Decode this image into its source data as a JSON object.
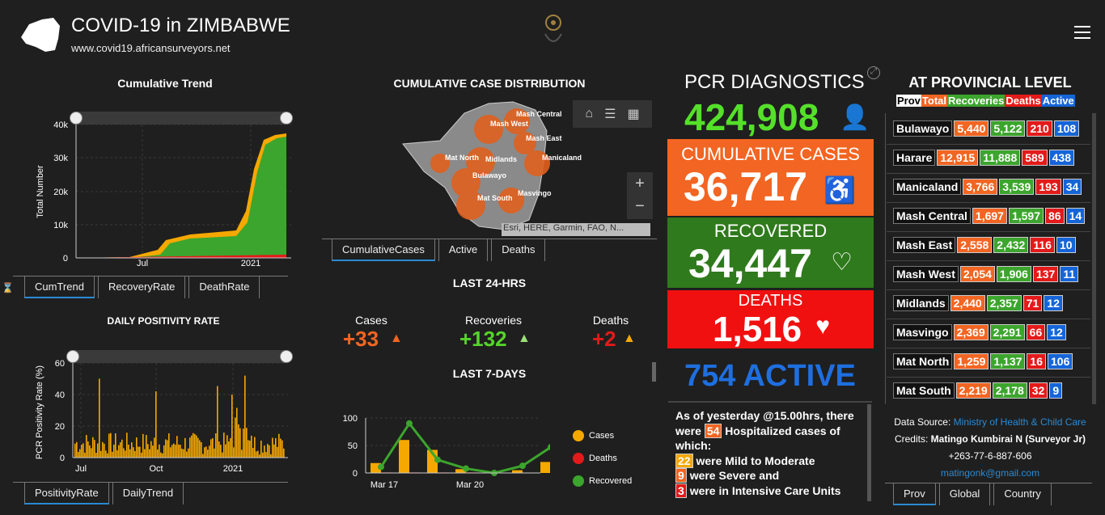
{
  "header": {
    "title": "COVID-19 in ZIMBABWE",
    "url": "www.covid19.africansurveyors.net"
  },
  "trend": {
    "title": "Cumulative Trend",
    "ylabel": "Total Number",
    "yticks": [
      "40k",
      "30k",
      "20k",
      "10k",
      "0"
    ],
    "xticks": [
      "Jul",
      "2021"
    ],
    "tabs": [
      "CumTrend",
      "RecoveryRate",
      "DeathRate"
    ]
  },
  "positivity": {
    "title": "DAILY POSITIVITY RATE",
    "ylabel": "PCR Positivity Rate (%)",
    "yticks": [
      "60",
      "40",
      "20",
      "0"
    ],
    "xticks": [
      "Jul",
      "Oct",
      "2021"
    ],
    "tabs": [
      "PositivityRate",
      "DailyTrend"
    ]
  },
  "map": {
    "title": "CUMULATIVE CASE DISTRIBUTION",
    "labels": [
      "Mash Central",
      "Mash West",
      "Mash East",
      "Manicaland",
      "Mat North",
      "Midlands",
      "Bulawayo",
      "Mat South",
      "Masvingo"
    ],
    "attribution": "Esri, HERE, Garmin, FAO, N...",
    "tabs": [
      "CumulativeCases",
      "Active",
      "Deaths"
    ],
    "zoom_in": "+",
    "zoom_out": "−"
  },
  "last24": {
    "title": "LAST 24-HRS",
    "cases_label": "Cases",
    "cases": "+33",
    "recoveries_label": "Recoveries",
    "recoveries": "+132",
    "deaths_label": "Deaths",
    "deaths": "+2"
  },
  "last7": {
    "title": "LAST 7-DAYS",
    "yticks": [
      "100",
      "50",
      "0"
    ],
    "xticks": [
      "Mar 17",
      "Mar 20"
    ],
    "legend": [
      "Cases",
      "Deaths",
      "Recovered"
    ]
  },
  "chart_data": {
    "type": "bar",
    "title": "LAST 7-DAYS",
    "categories": [
      "Mar 16",
      "Mar 17",
      "Mar 18",
      "Mar 19",
      "Mar 20",
      "Mar 21",
      "Mar 22"
    ],
    "ylim": [
      0,
      100
    ],
    "series": [
      {
        "name": "Cases",
        "type": "bar",
        "values": [
          18,
          60,
          42,
          7,
          0,
          5,
          20
        ]
      },
      {
        "name": "Deaths",
        "type": "bar",
        "values": [
          1,
          1,
          1,
          1,
          0,
          0,
          2
        ]
      },
      {
        "name": "Recovered",
        "type": "line",
        "values": [
          11,
          90,
          24,
          8,
          0,
          13,
          47
        ]
      }
    ]
  },
  "pcr": {
    "title": "PCR DIAGNOSTICS",
    "value": "424,908"
  },
  "cumulative": {
    "label": "CUMULATIVE CASES",
    "value": "36,717"
  },
  "recovered": {
    "label": "RECOVERED",
    "value": "34,447"
  },
  "deaths": {
    "label": "DEATHS",
    "value": "1,516"
  },
  "active": {
    "value": "754 ACTIVE"
  },
  "hospital": {
    "line1": "As of yesterday @15.00hrs, there",
    "line2a": "were",
    "count": "54",
    "line2b": "Hospitalized cases of",
    "line3": "which:",
    "mild_n": "22",
    "mild": "were Mild to Moderate",
    "severe_n": "9",
    "severe": "were Severe and",
    "icu_n": "3",
    "icu": "were in Intensive Care Units"
  },
  "provincial": {
    "title": "AT PROVINCIAL LEVEL",
    "legend": {
      "prov": "Prov",
      "total": "Total",
      "recoveries": "Recoveries",
      "deaths": "Deaths",
      "active": "Active"
    },
    "rows": [
      {
        "name": "Bulawayo",
        "total": "5,440",
        "rec": "5,122",
        "deaths": "210",
        "active": "108"
      },
      {
        "name": "Harare",
        "total": "12,915",
        "rec": "11,888",
        "deaths": "589",
        "active": "438"
      },
      {
        "name": "Manicaland",
        "total": "3,766",
        "rec": "3,539",
        "deaths": "193",
        "active": "34"
      },
      {
        "name": "Mash Central",
        "total": "1,697",
        "rec": "1,597",
        "deaths": "86",
        "active": "14"
      },
      {
        "name": "Mash East",
        "total": "2,558",
        "rec": "2,432",
        "deaths": "116",
        "active": "10"
      },
      {
        "name": "Mash West",
        "total": "2,054",
        "rec": "1,906",
        "deaths": "137",
        "active": "11"
      },
      {
        "name": "Midlands",
        "total": "2,440",
        "rec": "2,357",
        "deaths": "71",
        "active": "12"
      },
      {
        "name": "Masvingo",
        "total": "2,369",
        "rec": "2,291",
        "deaths": "66",
        "active": "12"
      },
      {
        "name": "Mat North",
        "total": "1,259",
        "rec": "1,137",
        "deaths": "16",
        "active": "106"
      },
      {
        "name": "Mat South",
        "total": "2,219",
        "rec": "2,178",
        "deaths": "32",
        "active": "9"
      }
    ],
    "source_label": "Data Source:",
    "source": "Ministry of Health & Child Care",
    "credits_label": "Credits:",
    "credits": "Matingo Kumbirai N (Surveyor Jr)",
    "phone": "+263-77-6-887-606",
    "email": "matingonk@gmail.com",
    "tabs": [
      "Prov",
      "Global",
      "Country"
    ]
  },
  "colors": {
    "cases": "#f26522",
    "recovered": "#3ca52d",
    "deaths": "#e41a1a",
    "active": "#1565d8",
    "trend_total": "#f5a800"
  }
}
